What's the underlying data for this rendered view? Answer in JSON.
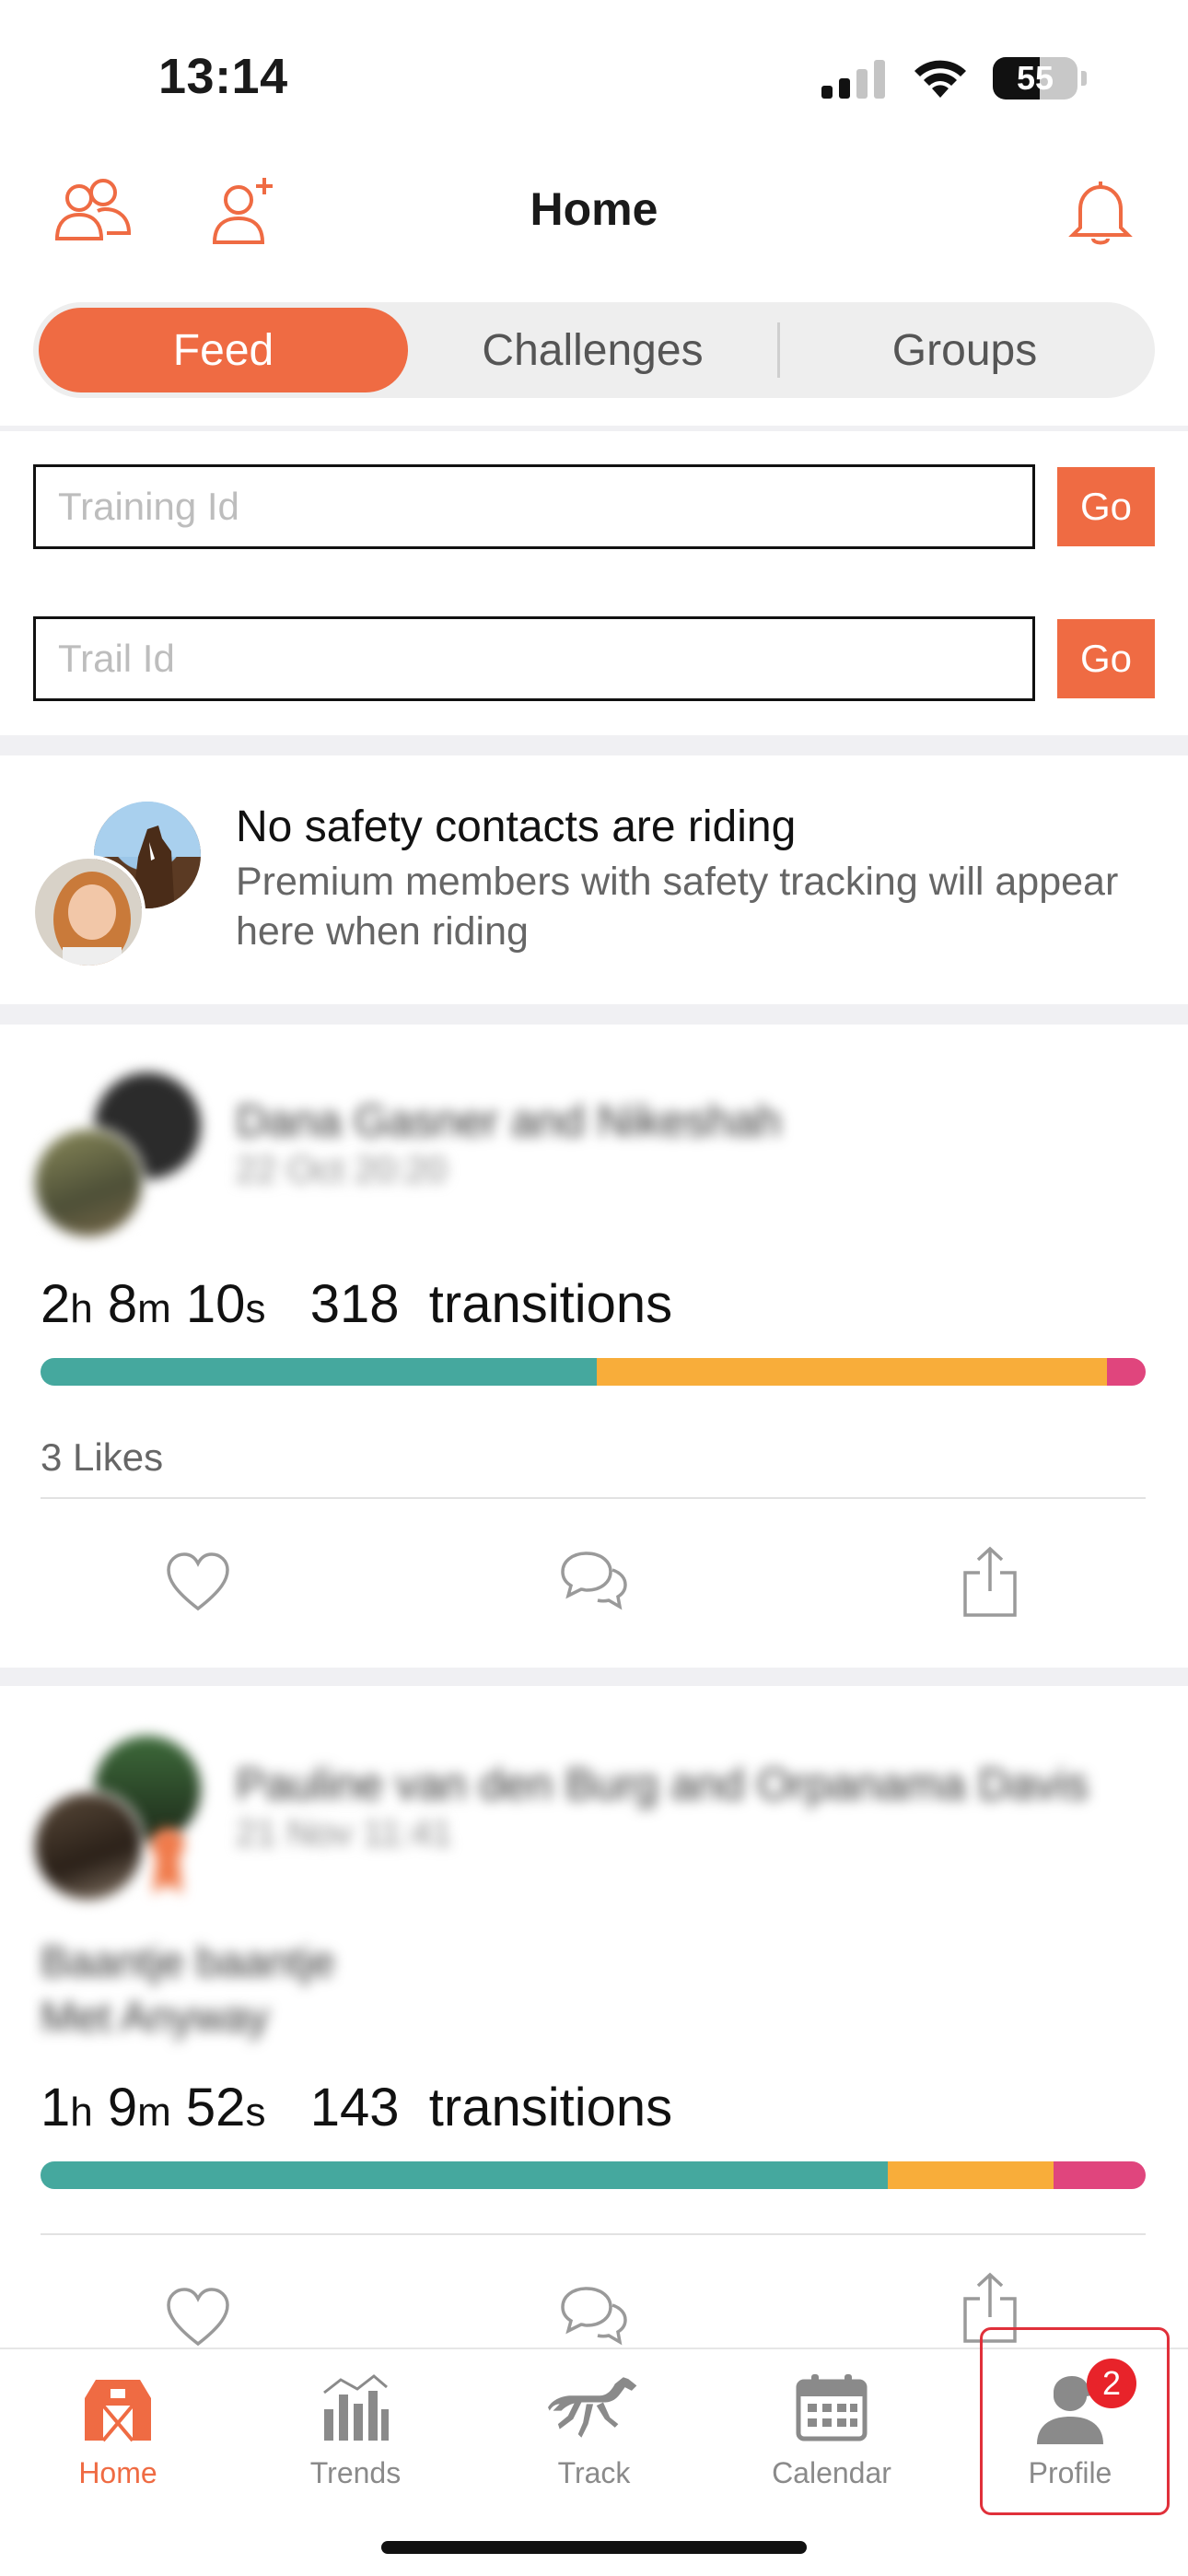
{
  "status_bar": {
    "time": "13:14",
    "battery": "55"
  },
  "header": {
    "title": "Home"
  },
  "tabs": [
    {
      "label": "Feed",
      "active": true
    },
    {
      "label": "Challenges",
      "active": false
    },
    {
      "label": "Groups",
      "active": false
    }
  ],
  "inputs": {
    "training_placeholder": "Training Id",
    "trail_placeholder": "Trail Id",
    "go_label": "Go"
  },
  "safety": {
    "title": "No safety contacts are riding",
    "subtitle": "Premium members with safety tracking will appear here when riding"
  },
  "posts": [
    {
      "name": "Dana Gasner and Nikeshah",
      "date": "22 Oct 20:20",
      "duration_h": "2",
      "duration_m": "8",
      "duration_s": "10",
      "transitions": "318",
      "transitions_label": "transitions",
      "segments": [
        0.503,
        0.462,
        0.035
      ],
      "likes": "3 Likes"
    },
    {
      "name": "Pauline van den Burg and Orpanama Davis",
      "date": "21 Nov 11:41",
      "title_line1": "Baantje baantje",
      "title_line2": "Met Anyway",
      "duration_h": "1",
      "duration_m": "9",
      "duration_s": "52",
      "transitions": "143",
      "transitions_label": "transitions",
      "segments": [
        0.767,
        0.15,
        0.083
      ]
    }
  ],
  "units": {
    "h": "h",
    "m": "m",
    "s": "s"
  },
  "colors": {
    "accent": "#ef6b43",
    "walk": "#45a89e",
    "trot": "#f8ad3a",
    "canter": "#e0457d"
  },
  "bottom_tabs": [
    {
      "label": "Home",
      "icon": "barn-icon",
      "active": true
    },
    {
      "label": "Trends",
      "icon": "trends-icon",
      "active": false
    },
    {
      "label": "Track",
      "icon": "horse-icon",
      "active": false
    },
    {
      "label": "Calendar",
      "icon": "calendar-icon",
      "active": false
    },
    {
      "label": "Profile",
      "icon": "profile-icon",
      "active": false,
      "badge": "2"
    }
  ]
}
